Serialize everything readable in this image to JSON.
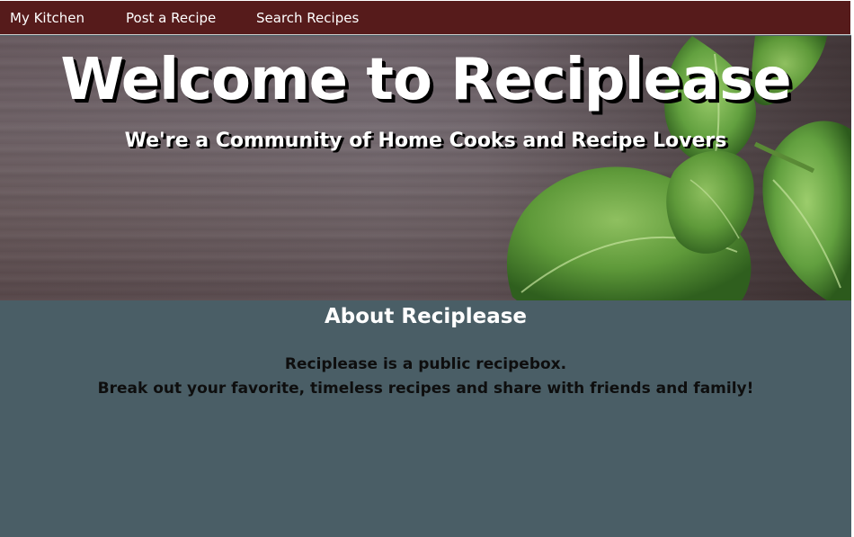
{
  "nav": {
    "items": [
      {
        "label": "My Kitchen"
      },
      {
        "label": "Post a Recipe"
      },
      {
        "label": "Search Recipes"
      }
    ]
  },
  "hero": {
    "title": "Welcome to Reciplease",
    "subtitle": "We're a Community of Home Cooks and Recipe Lovers",
    "image": "basil-leaves-on-wood-background"
  },
  "about": {
    "heading": "About Reciplease",
    "lines": [
      "Reciplease is a public recipebox.",
      "Break out your favorite, timeless recipes and share with friends and family!"
    ]
  },
  "colors": {
    "nav_background": "#561b1b",
    "page_background": "#4a5e66",
    "hero_text": "#ffffff",
    "about_text": "#0e0e0e"
  }
}
